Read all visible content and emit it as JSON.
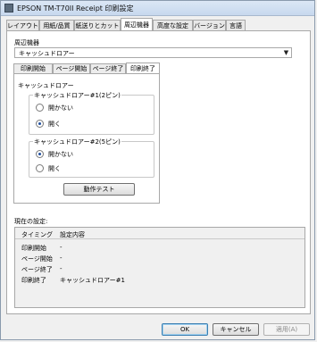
{
  "window": {
    "title": "EPSON TM-T70II Receipt 印刷設定"
  },
  "top_tabs": [
    "レイアウト",
    "用紙/品質",
    "紙送りとカット",
    "周辺機器",
    "高度な設定",
    "バージョン",
    "言語"
  ],
  "peripheral": {
    "section_label": "周辺機器",
    "device_selected": "キャッシュドロアー"
  },
  "sub_tabs": [
    "印刷開始",
    "ページ開始",
    "ページ終了",
    "印刷終了"
  ],
  "drawer": {
    "group_label": "キャッシュドロアー",
    "drawer1": {
      "label": "キャッシュドロアー#1(2ピン)",
      "options": [
        "開かない",
        "開く"
      ],
      "selected": "開く"
    },
    "drawer2": {
      "label": "キャッシュドロアー#2(5ピン)",
      "options": [
        "開かない",
        "開く"
      ],
      "selected": "開かない"
    },
    "test_button": "動作テスト"
  },
  "current_settings": {
    "label": "現在の設定:",
    "columns": [
      "タイミング",
      "設定内容"
    ],
    "rows": [
      {
        "timing": "印刷開始",
        "content": "-"
      },
      {
        "timing": "ページ開始",
        "content": "-"
      },
      {
        "timing": "ページ終了",
        "content": "-"
      },
      {
        "timing": "印刷終了",
        "content": "キャッシュドロアー#1"
      }
    ]
  },
  "buttons": {
    "ok": "OK",
    "cancel": "キャンセル",
    "apply": "適用(A)"
  }
}
